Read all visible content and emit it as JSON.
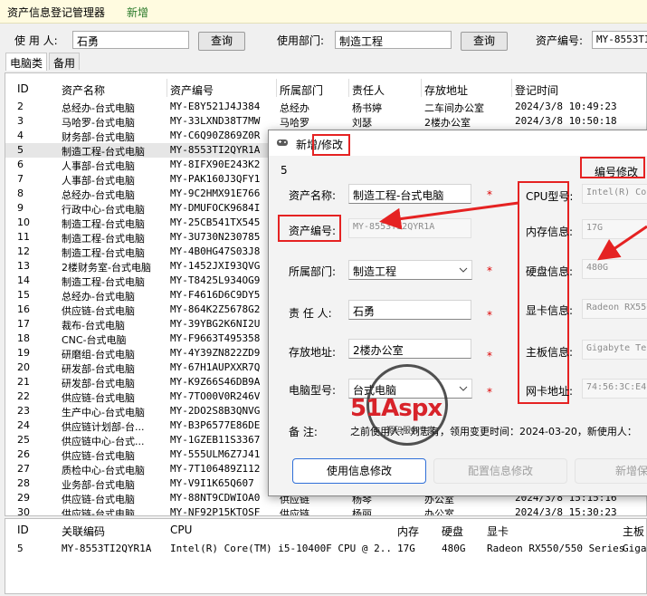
{
  "menu": {
    "title": "资产信息登记管理器",
    "new": "新增"
  },
  "search": {
    "user_label": "使 用 人:",
    "user_value": "石勇",
    "query1": "查询",
    "dept_label": "使用部门:",
    "dept_value": "制造工程",
    "query2": "查询",
    "code_label": "资产编号:",
    "code_value": "MY-8553TI2QYR1A"
  },
  "tabs": [
    "电脑类",
    "备用"
  ],
  "table": {
    "headers": [
      "ID",
      "资产名称",
      "资产编号",
      "所属部门",
      "责任人",
      "存放地址",
      "登记时间"
    ],
    "rows": [
      [
        "2",
        "总经办-台式电脑",
        "MY-E8Y521J4J384",
        "总经办",
        "杨书婷",
        "二车间办公室",
        "2024/3/8 10:49:23"
      ],
      [
        "3",
        "马哈罗-台式电脑",
        "MY-33LXND38T7MW",
        "马哈罗",
        "刘瑟",
        "2楼办公室",
        "2024/3/8 10:50:18"
      ],
      [
        "4",
        "财务部-台式电脑",
        "MY-C6Q90Z869Z0R",
        "",
        "",
        "",
        ""
      ],
      [
        "5",
        "制造工程-台式电脑",
        "MY-8553TI2QYR1A",
        "",
        "",
        "",
        ""
      ],
      [
        "6",
        "人事部-台式电脑",
        "MY-8IFX90E243K2",
        "",
        "",
        "",
        ""
      ],
      [
        "7",
        "人事部-台式电脑",
        "MY-PAK160J3QFY1",
        "",
        "",
        "",
        ""
      ],
      [
        "8",
        "总经办-台式电脑",
        "MY-9C2HMX91E766",
        "",
        "",
        "",
        ""
      ],
      [
        "9",
        "行政中心-台式电脑",
        "MY-DMUFOCK9684I",
        "",
        "",
        "",
        ""
      ],
      [
        "10",
        "制造工程-台式电脑",
        "MY-25CB541TX545",
        "",
        "",
        "",
        ""
      ],
      [
        "11",
        "制造工程-台式电脑",
        "MY-3U730N230785",
        "",
        "",
        "",
        ""
      ],
      [
        "12",
        "制造工程-台式电脑",
        "MY-4B0HG47S03J8",
        "",
        "",
        "",
        ""
      ],
      [
        "13",
        "2楼财务室-台式电脑",
        "MY-1452JXI93QVG",
        "",
        "",
        "",
        ""
      ],
      [
        "14",
        "制造工程-台式电脑",
        "MY-T8425L934OG9",
        "",
        "",
        "",
        ""
      ],
      [
        "15",
        "总经办-台式电脑",
        "MY-F4616D6C9DY5",
        "",
        "",
        "",
        ""
      ],
      [
        "16",
        "供应链-台式电脑",
        "MY-864K2Z5678G2",
        "",
        "",
        "",
        ""
      ],
      [
        "17",
        "裁布-台式电脑",
        "MY-39YBG2K6NI2U",
        "",
        "",
        "",
        ""
      ],
      [
        "18",
        "CNC-台式电脑",
        "MY-F9663T495358",
        "",
        "",
        "",
        ""
      ],
      [
        "19",
        "研磨组-台式电脑",
        "MY-4Y39ZN822ZD9",
        "",
        "",
        "",
        ""
      ],
      [
        "20",
        "研发部-台式电脑",
        "MY-67H1AUPXXR7Q",
        "",
        "",
        "",
        ""
      ],
      [
        "21",
        "研发部-台式电脑",
        "MY-K9Z66S46DB9A",
        "",
        "",
        "",
        ""
      ],
      [
        "22",
        "供应链-台式电脑",
        "MY-7TO00V0R246V",
        "",
        "",
        "",
        ""
      ],
      [
        "23",
        "生产中心-台式电脑",
        "MY-2DO2S8B3QNVG",
        "",
        "",
        "",
        ""
      ],
      [
        "24",
        "供应链计划部-台...",
        "MY-B3P6577E86DE",
        "",
        "",
        "",
        ""
      ],
      [
        "25",
        "供应链中心-台式...",
        "MY-1GZEB11S3367",
        "",
        "",
        "",
        ""
      ],
      [
        "26",
        "供应链-台式电脑",
        "MY-555ULM6Z7J41",
        "",
        "",
        "",
        ""
      ],
      [
        "27",
        "质检中心-台式电脑",
        "MY-7T106489Z112",
        "",
        "",
        "",
        ""
      ],
      [
        "28",
        "业务部-台式电脑",
        "MY-V9I1K65Q607",
        "",
        "",
        "",
        ""
      ],
      [
        "29",
        "供应链-台式电脑",
        "MY-88NT9CDWIOA0",
        "供应链",
        "杨琴",
        "办公室",
        "2024/3/8 15:15:16"
      ],
      [
        "30",
        "供应链-台式电脑",
        "MY-NF92P15KTOSF",
        "供应链",
        "杨丽",
        "办公室",
        "2024/3/8 15:30:23"
      ]
    ]
  },
  "detail": {
    "headers": [
      "ID",
      "关联编码",
      "CPU",
      "内存",
      "硬盘",
      "显卡",
      "主板"
    ],
    "row": [
      "5",
      "MY-8553TI2QYR1A",
      "Intel(R) Core(TM) i5-10400F CPU @ 2....",
      "17G",
      "480G",
      "Radeon RX550/550 Series",
      "Giga"
    ]
  },
  "dialog": {
    "title": "新增/修改",
    "id_value": "5",
    "code_edit_label": "编号修改",
    "name_label": "资产名称:",
    "name_value": "制造工程-台式电脑",
    "code_label": "资产编号:",
    "code_value": "MY-8553TI2QYR1A",
    "dept_label": "所属部门:",
    "dept_value": "制造工程",
    "owner_label": "责 任 人:",
    "owner_value": "石勇",
    "location_label": "存放地址:",
    "location_value": "2楼办公室",
    "model_label": "电脑型号:",
    "model_value": "台式电脑",
    "cpu_label": "CPU型号:",
    "cpu_value": "Intel(R) Cor",
    "mem_label": "内存信息:",
    "mem_value": "17G",
    "disk_label": "硬盘信息:",
    "disk_value": "480G",
    "gpu_label": "显卡信息:",
    "gpu_value": "Radeon RX550",
    "board_label": "主板信息:",
    "board_value": "Gigabyte Tec",
    "mac_label": "网卡地址:",
    "mac_value": "74:56:3C:E4",
    "note_label": "备    注:",
    "note_value": "之前使用人：刘志有，领用变更时间：2024-03-20，新使用人：",
    "btn_user_change": "使用信息修改",
    "btn_config_change": "配置信息修改",
    "btn_save": "新增保",
    "required_mark": "*"
  },
  "watermark": {
    "brand": "51Aspx",
    "sub": "源码服务专家"
  },
  "colors": {
    "annotation": "#e52222",
    "menubar": "#fffbe0",
    "accent_blue": "#2f6fd8"
  }
}
